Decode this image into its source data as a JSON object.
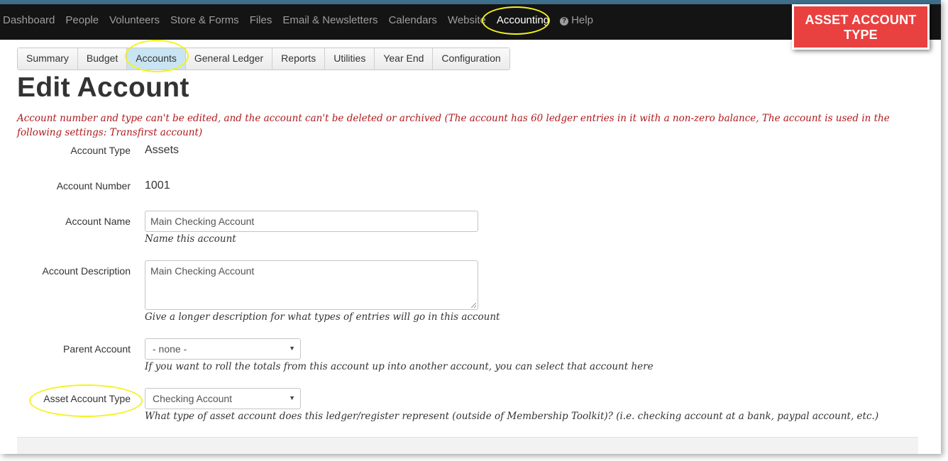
{
  "topnav": {
    "items": [
      "Dashboard",
      "People",
      "Volunteers",
      "Store & Forms",
      "Files",
      "Email & Newsletters",
      "Calendars",
      "Website"
    ],
    "active": "Accounting",
    "help": "Help"
  },
  "callout": {
    "line1": "ASSET ACCOUNT",
    "line2": "TYPE"
  },
  "subnav": {
    "tabs": [
      "Summary",
      "Budget",
      "Accounts",
      "General Ledger",
      "Reports",
      "Utilities",
      "Year End",
      "Configuration"
    ],
    "active": "Accounts"
  },
  "page": {
    "title": "Edit Account",
    "warning": "Account number and type can't be edited, and the account can't be deleted or archived (The account has 60 ledger entries in it with a non-zero balance, The account is used in the following settings: Transfirst account)"
  },
  "form": {
    "account_type": {
      "label": "Account Type",
      "value": "Assets"
    },
    "account_number": {
      "label": "Account Number",
      "value": "1001"
    },
    "account_name": {
      "label": "Account Name",
      "value": "Main Checking Account",
      "help": "Name this account"
    },
    "account_description": {
      "label": "Account Description",
      "value": "Main Checking Account",
      "help": "Give a longer description for what types of entries will go in this account"
    },
    "parent_account": {
      "label": "Parent Account",
      "value": "- none -",
      "help": "If you want to roll the totals from this account up into another account, you can select that account here"
    },
    "asset_account_type": {
      "label": "Asset Account Type",
      "value": "Checking Account",
      "help": "What type of asset account does this ledger/register represent (outside of Membership Toolkit)? (i.e. checking account at a bank, paypal account, etc.)"
    }
  },
  "colors": {
    "navbar": "#141414",
    "callout": "#e8413f",
    "highlight": "#f5f31b",
    "warning": "#b0181c",
    "active_tab": "#c9e4f2"
  }
}
